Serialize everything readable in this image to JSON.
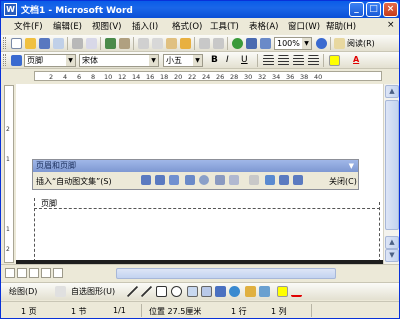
{
  "window": {
    "title": "文档1 - Microsoft Word",
    "app_icon": "W"
  },
  "title_buttons": {
    "minimize": "_",
    "maximize": "□",
    "close": "×"
  },
  "menu": {
    "items": [
      "文件(F)",
      "编辑(E)",
      "视图(V)",
      "插入(I)",
      "格式(O)",
      "工具(T)",
      "表格(A)",
      "窗口(W)",
      "帮助(H)"
    ],
    "close_doc": "×"
  },
  "toolbar_standard": {
    "zoom": "100%",
    "read_label": "阅读(R)"
  },
  "toolbar_format": {
    "style": "页脚",
    "font": "宋体",
    "size": "小五",
    "bold": "B",
    "italic": "I",
    "underline": "U",
    "font_color_label": "A"
  },
  "ruler": {
    "h_marks": [
      "8",
      "6",
      "4",
      "2",
      "",
      "2",
      "4",
      "6",
      "8",
      "10",
      "12",
      "14",
      "16",
      "18",
      "20",
      "22",
      "24",
      "26",
      "28",
      "30",
      "32",
      "34",
      "36",
      "38",
      "40"
    ],
    "v_marks": [
      "2",
      "1",
      "",
      "1",
      "2"
    ]
  },
  "hf_toolbar": {
    "title": "页眉和页脚",
    "insert_autotext": "插入“自动图文集”(S)",
    "close": "关闭(C)"
  },
  "document": {
    "footer_label": "页脚"
  },
  "drawbar": {
    "draw": "绘图(D)",
    "autoshapes": "自选图形(U)"
  },
  "status": {
    "page": "1 页",
    "section": "1 节",
    "pages": "1/1",
    "position": "位置 27.5厘米",
    "line": "1 行",
    "col": "1 列"
  },
  "colors": {
    "title_blue": "#0a5ce8",
    "hf_header": "#8aa4dc",
    "highlight": "#ffff00",
    "font_red": "#e00000"
  }
}
